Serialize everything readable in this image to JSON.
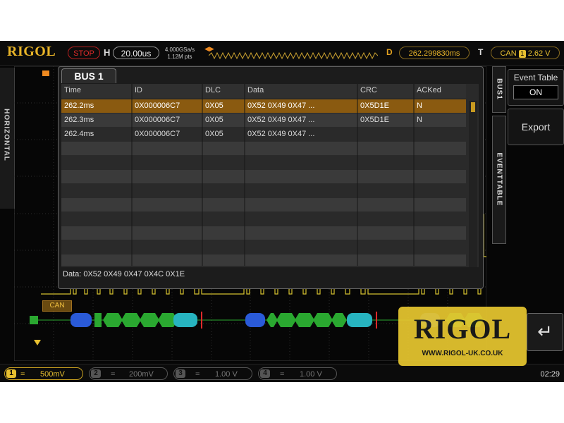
{
  "header": {
    "brand": "RIGOL",
    "run_state": "STOP",
    "horizontal_mark": "H",
    "timebase": "20.00us",
    "sample_rate": "4.000GSa/s",
    "memory_depth": "1.12M pts",
    "delay_mark": "D",
    "delay": "262.299830ms",
    "trigger_mark": "T",
    "trigger_source": "CAN",
    "trigger_level_icon": "1",
    "trigger_level": "2.62 V"
  },
  "left_tab": {
    "label": "HORIZONTAL"
  },
  "bus_popup": {
    "title": "BUS 1",
    "columns": [
      "Time",
      "ID",
      "DLC",
      "Data",
      "CRC",
      "ACKed"
    ],
    "rows": [
      {
        "time": "262.2ms",
        "id": "0X000006C7",
        "dlc": "0X05",
        "data": "0X52 0X49 0X47 ...",
        "crc": "0X5D1E",
        "acked": "N"
      },
      {
        "time": "262.3ms",
        "id": "0X000006C7",
        "dlc": "0X05",
        "data": "0X52 0X49 0X47 ...",
        "crc": "0X5D1E",
        "acked": "N"
      },
      {
        "time": "262.4ms",
        "id": "0X000006C7",
        "dlc": "0X05",
        "data": "0X52 0X49 0X47 ...",
        "crc": "",
        "acked": ""
      }
    ],
    "selected_row": 0,
    "status_line": "Data: 0X52 0X49 0X47 0X4C 0X1E"
  },
  "right_panel": {
    "tab_bus": "BUS1",
    "tab_eventtable": "EVENTTABLE",
    "event_table_label": "Event Table",
    "event_table_value": "ON",
    "export_label": "Export"
  },
  "waveform": {
    "bus_label": "CAN",
    "ch1_marker": "1",
    "bus_marker": "B",
    "colors": {
      "ch1": "#d4c030",
      "packet_id": "#2a5ad8",
      "packet_data": "#2aa830",
      "packet_crc": "#27b4c0"
    }
  },
  "channels": [
    {
      "num": "1",
      "scale": "500mV",
      "active": true
    },
    {
      "num": "2",
      "scale": "200mV",
      "active": false
    },
    {
      "num": "3",
      "scale": "1.00 V",
      "active": false
    },
    {
      "num": "4",
      "scale": "1.00 V",
      "active": false
    }
  ],
  "coupling_symbol": "=",
  "clock": "02:29",
  "watermark": {
    "brand": "RIGOL",
    "url": "WWW.RIGOL-UK.CO.UK"
  }
}
